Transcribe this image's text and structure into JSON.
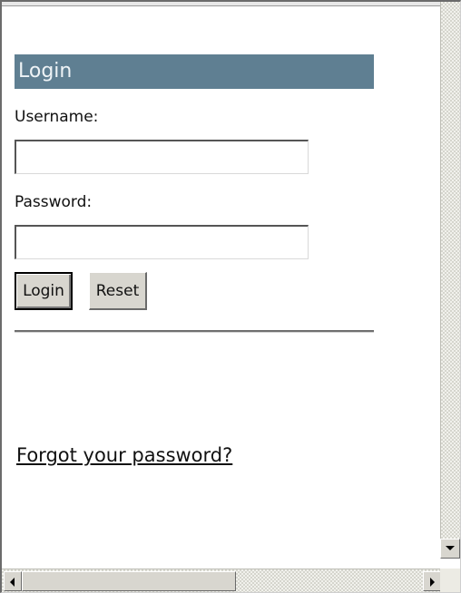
{
  "login": {
    "header": "Login",
    "username_label": "Username:",
    "username_value": "",
    "password_label": "Password:",
    "password_value": "",
    "login_button": "Login",
    "reset_button": "Reset",
    "forgot_link": "Forgot your password?"
  },
  "icons": {
    "scroll_left": "arrow-left-icon",
    "scroll_right": "arrow-right-icon",
    "scroll_down": "arrow-down-icon"
  },
  "colors": {
    "header_bg": "#5f7f92",
    "header_text": "#eef3f6",
    "button_face": "#d8d6cf"
  }
}
